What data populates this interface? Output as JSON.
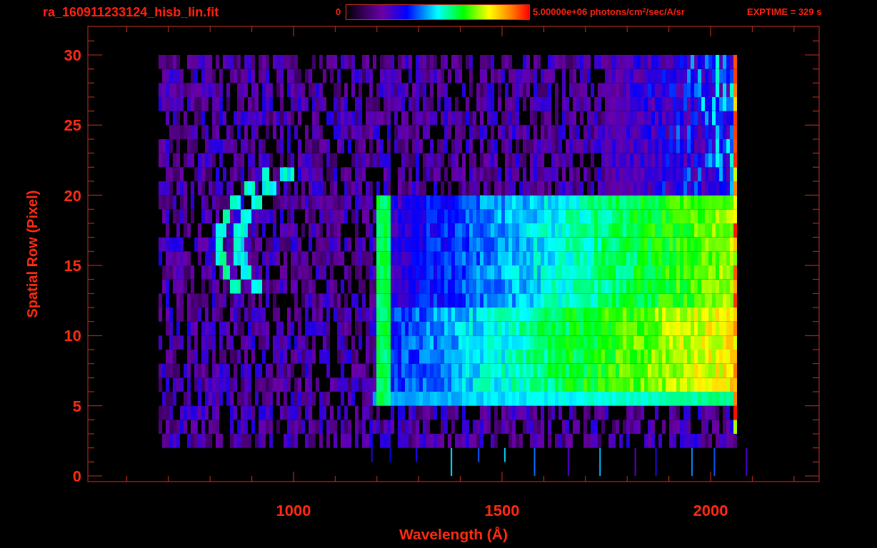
{
  "title": "ra_160911233124_hisb_lin.fit",
  "colorbar": {
    "min_label": "0",
    "max_label": "5.00000e+06 photons/cm$^{2}$/sec/A/sr"
  },
  "exposure": "EXPTIME = 329 s",
  "plot": {
    "ylabel": "Spatial Row (Pixel)",
    "xlabel": "Wavelength (Å)",
    "yticks": [
      "30",
      "25",
      "20",
      "15",
      "10",
      "5",
      "0"
    ],
    "xticks": [
      "1000",
      "1500",
      "2000"
    ]
  }
}
